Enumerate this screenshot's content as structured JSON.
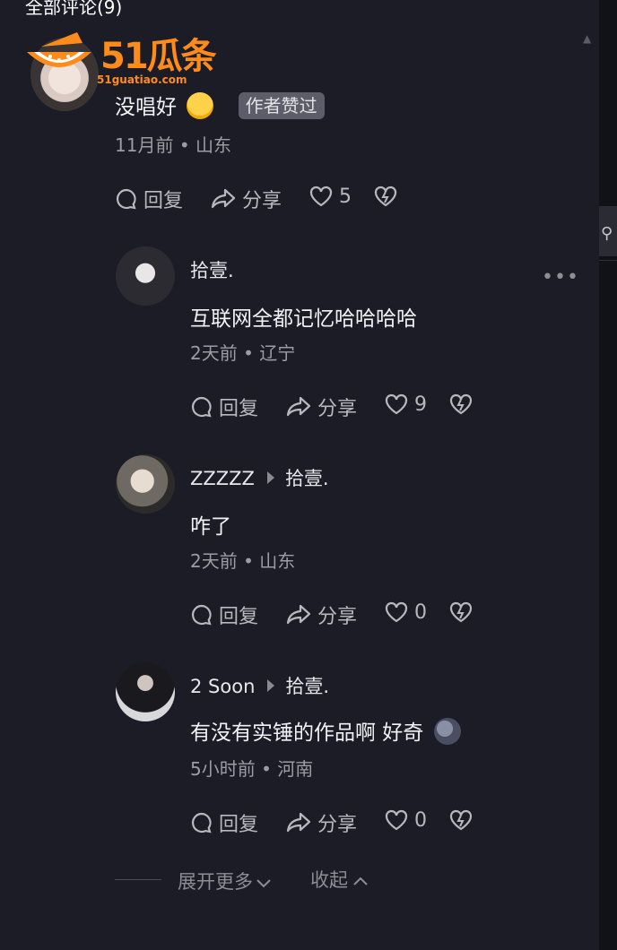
{
  "header": {
    "title": "全部评论(9)"
  },
  "watermark": {
    "brand": "51瓜条",
    "domain": "51guatiao.com",
    "color": "#ff8c1a"
  },
  "comments": [
    {
      "username": "",
      "text": "没唱好",
      "emoji_icon": "crying-face-emoji",
      "badge": "作者赞过",
      "time": "11月前",
      "location": "山东",
      "reply_label": "回复",
      "share_label": "分享",
      "likes": "5"
    },
    {
      "username": "拾壹.",
      "text": "互联网全都记忆哈哈哈哈",
      "time": "2天前",
      "location": "辽宁",
      "reply_label": "回复",
      "share_label": "分享",
      "likes": "9"
    },
    {
      "username": "ZZZZZ",
      "reply_to": "拾壹.",
      "text": "咋了",
      "time": "2天前",
      "location": "山东",
      "reply_label": "回复",
      "share_label": "分享",
      "likes": "0"
    },
    {
      "username": "2 Soon",
      "reply_to": "拾壹.",
      "text": "有没有实锤的作品啊 好奇",
      "emoji_icon": "new-moon-face-emoji",
      "time": "5小时前",
      "location": "河南",
      "reply_label": "回复",
      "share_label": "分享",
      "likes": "0"
    }
  ],
  "controls": {
    "expand_more": "展开更多",
    "collapse": "收起",
    "more_dots": "•••"
  },
  "meta_separator": "•"
}
